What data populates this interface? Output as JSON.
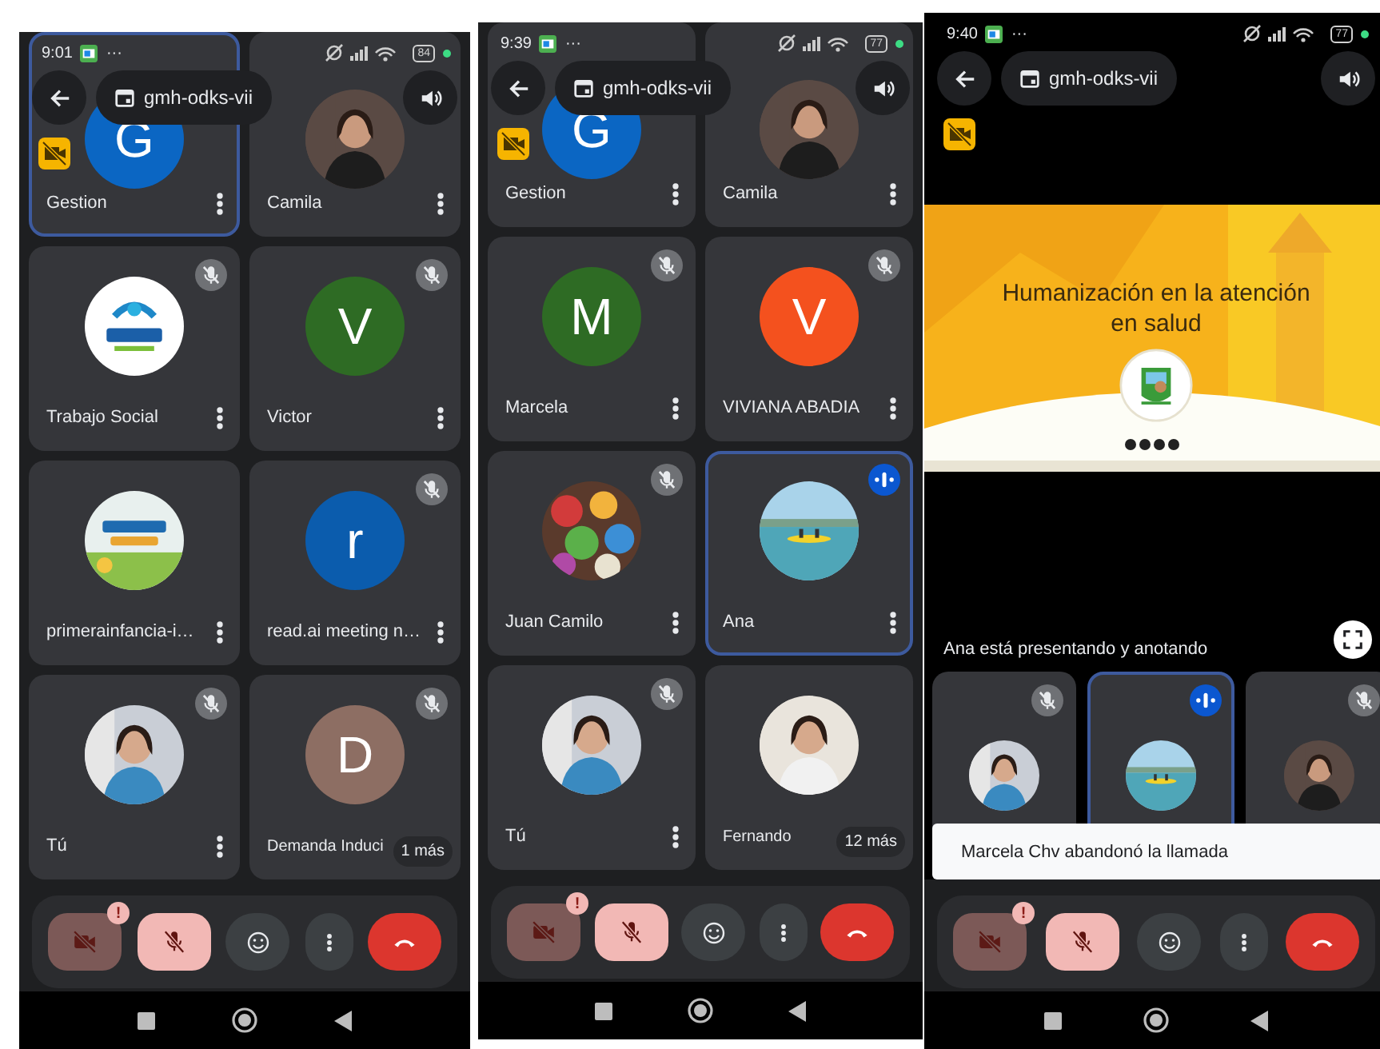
{
  "phones": [
    {
      "status_bar": {
        "time": "9:01",
        "more": "···",
        "battery": "84"
      },
      "meeting": {
        "title": "gmh-odks-vii"
      },
      "tiles": [
        {
          "name": "Gestion",
          "highlighted": true,
          "muted": false,
          "speaking": false,
          "avatar": {
            "kind": "letter",
            "letter": "G",
            "color": "#0b66c3"
          }
        },
        {
          "name": "Camila",
          "highlighted": false,
          "muted": false,
          "speaking": false
        },
        {
          "name": "Trabajo Social",
          "highlighted": false,
          "muted": true,
          "speaking": false
        },
        {
          "name": "Victor",
          "highlighted": false,
          "muted": true,
          "speaking": false,
          "avatar": {
            "kind": "letter",
            "letter": "V",
            "color": "#2e6b24"
          }
        },
        {
          "name": "primerainfancia-i…",
          "highlighted": false,
          "muted": false,
          "speaking": false
        },
        {
          "name": "read.ai meeting n…",
          "highlighted": false,
          "muted": true,
          "speaking": false,
          "avatar": {
            "kind": "letter",
            "letter": "r",
            "color": "#0b5cad"
          }
        },
        {
          "name": "Tú",
          "highlighted": false,
          "muted": true,
          "speaking": false
        },
        {
          "name": "Demanda Induci",
          "highlighted": false,
          "muted": true,
          "speaking": false,
          "avatar": {
            "kind": "letter",
            "letter": "D",
            "color": "#8d6e63"
          },
          "overflow": "1 más"
        }
      ],
      "controls": [
        {
          "kind": "camera",
          "off": true,
          "alert": "!"
        },
        {
          "kind": "mic",
          "off": true
        },
        {
          "kind": "reactions"
        },
        {
          "kind": "more"
        },
        {
          "kind": "hangup"
        }
      ]
    },
    {
      "status_bar": {
        "time": "9:39",
        "more": "···",
        "battery": "77"
      },
      "meeting": {
        "title": "gmh-odks-vii"
      },
      "tiles": [
        {
          "name": "Gestion",
          "highlighted": false,
          "muted": false,
          "speaking": false,
          "avatar": {
            "kind": "letter",
            "letter": "G",
            "color": "#0b66c3"
          }
        },
        {
          "name": "Camila",
          "highlighted": false,
          "muted": false,
          "speaking": false
        },
        {
          "name": "Marcela",
          "highlighted": false,
          "muted": true,
          "speaking": false,
          "avatar": {
            "kind": "letter",
            "letter": "M",
            "color": "#2e6b24"
          }
        },
        {
          "name": "VIVIANA ABADIA",
          "highlighted": false,
          "muted": true,
          "speaking": false,
          "avatar": {
            "kind": "letter",
            "letter": "V",
            "color": "#f4511e"
          }
        },
        {
          "name": "Juan Camilo",
          "highlighted": false,
          "muted": true,
          "speaking": false
        },
        {
          "name": "Ana",
          "highlighted": true,
          "muted": false,
          "speaking": true
        },
        {
          "name": "Tú",
          "highlighted": false,
          "muted": true,
          "speaking": false
        },
        {
          "name": "Fernando",
          "highlighted": false,
          "muted": false,
          "speaking": false,
          "overflow": "12 más"
        }
      ],
      "controls": [
        {
          "kind": "camera",
          "off": true,
          "alert": "!"
        },
        {
          "kind": "mic",
          "off": true
        },
        {
          "kind": "reactions"
        },
        {
          "kind": "more"
        },
        {
          "kind": "hangup"
        }
      ]
    },
    {
      "status_bar": {
        "time": "9:40",
        "more": "···",
        "battery": "77"
      },
      "meeting": {
        "title": "gmh-odks-vii"
      },
      "presentation": {
        "title": "Humanización en la atención en salud"
      },
      "caption": "Ana está presentando y anotando",
      "tiles": [
        {
          "highlighted": false,
          "muted": true,
          "speaking": false
        },
        {
          "highlighted": true,
          "muted": false,
          "speaking": true
        },
        {
          "highlighted": false,
          "muted": true,
          "speaking": false
        }
      ],
      "toast": "Marcela Chv abandonó la llamada",
      "controls": [
        {
          "kind": "camera",
          "off": true,
          "alert": "!"
        },
        {
          "kind": "mic",
          "off": true
        },
        {
          "kind": "reactions"
        },
        {
          "kind": "more"
        },
        {
          "kind": "hangup"
        }
      ]
    }
  ]
}
